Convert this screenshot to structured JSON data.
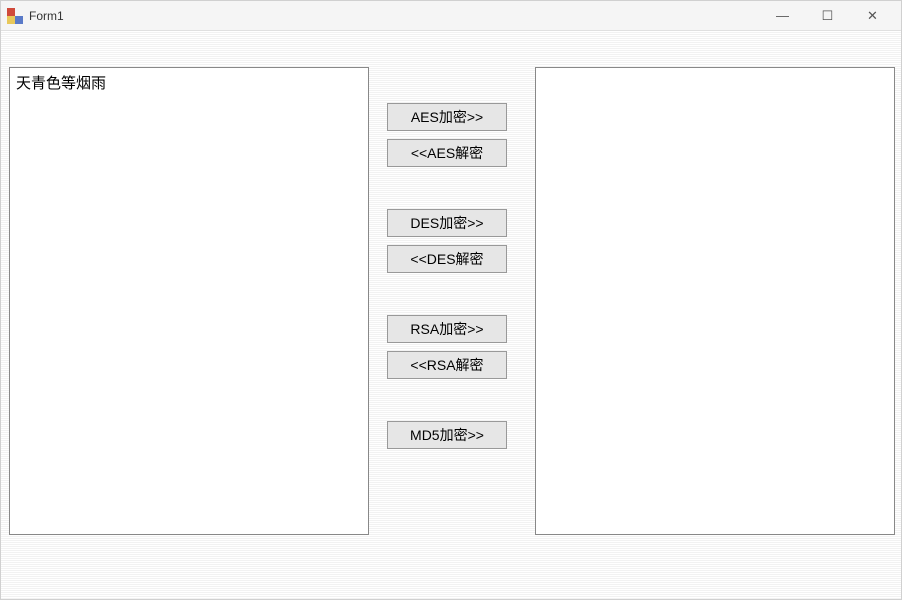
{
  "window": {
    "title": "Form1"
  },
  "titlebar_controls": {
    "minimize": "—",
    "maximize": "☐",
    "close": "✕"
  },
  "textboxes": {
    "left_value": "天青色等烟雨",
    "right_value": ""
  },
  "buttons": {
    "aes_encrypt": "AES加密>>",
    "aes_decrypt": "<<AES解密",
    "des_encrypt": "DES加密>>",
    "des_decrypt": "<<DES解密",
    "rsa_encrypt": "RSA加密>>",
    "rsa_decrypt": "<<RSA解密",
    "md5_encrypt": "MD5加密>>"
  }
}
